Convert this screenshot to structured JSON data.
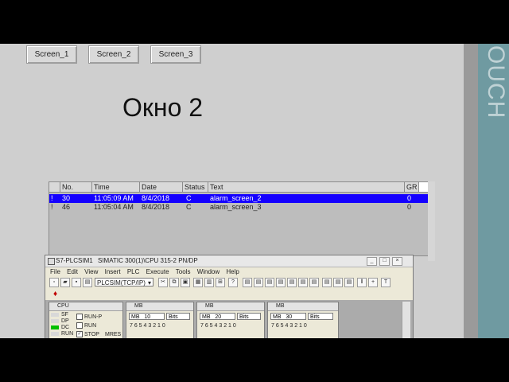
{
  "hmi": {
    "nav": [
      "Screen_1",
      "Screen_2",
      "Screen_3"
    ],
    "title": "Окно 2",
    "brand": "OUCH"
  },
  "alarm_view": {
    "columns": [
      "No.",
      "Time",
      "Date",
      "Status",
      "Text",
      "GR"
    ],
    "rows": [
      {
        "flag": "!",
        "no": "30",
        "time": "11:05:09 AM",
        "date": "8/4/2018",
        "status": "C",
        "text": "alarm_screen_2",
        "gr": "0",
        "selected": true
      },
      {
        "flag": "!",
        "no": "46",
        "time": "11:05:04 AM",
        "date": "8/4/2018",
        "status": "C",
        "text": "alarm_screen_3",
        "gr": "0",
        "selected": false
      }
    ]
  },
  "plcsim": {
    "title_app": "S7-PLCSIM1",
    "title_project": "SIMATIC 300(1)\\CPU 315-2 PN/DP",
    "menu": [
      "File",
      "Edit",
      "View",
      "Insert",
      "PLC",
      "Execute",
      "Tools",
      "Window",
      "Help"
    ],
    "interface_select": "PLCSIM(TCP/IP)",
    "cpu": {
      "title": "CPU",
      "leds": [
        {
          "label": "SF",
          "color": "#d8d8d8"
        },
        {
          "label": "DP",
          "color": "#d8d8d8"
        },
        {
          "label": "DC",
          "color": "#00c000"
        },
        {
          "label": "RUN",
          "color": "#d8d8d8"
        }
      ],
      "modes": [
        "RUN-P",
        "RUN",
        "STOP"
      ],
      "mres": "MRES"
    },
    "mb_windows": [
      {
        "title": "MB",
        "type": "MB",
        "address": "10",
        "format": "Bits"
      },
      {
        "title": "MB",
        "type": "MB",
        "address": "20",
        "format": "Bits"
      },
      {
        "title": "MB",
        "type": "MB",
        "address": "30",
        "format": "Bits"
      }
    ],
    "bit_labels": "7 6 5 4   3 2 1 0"
  }
}
